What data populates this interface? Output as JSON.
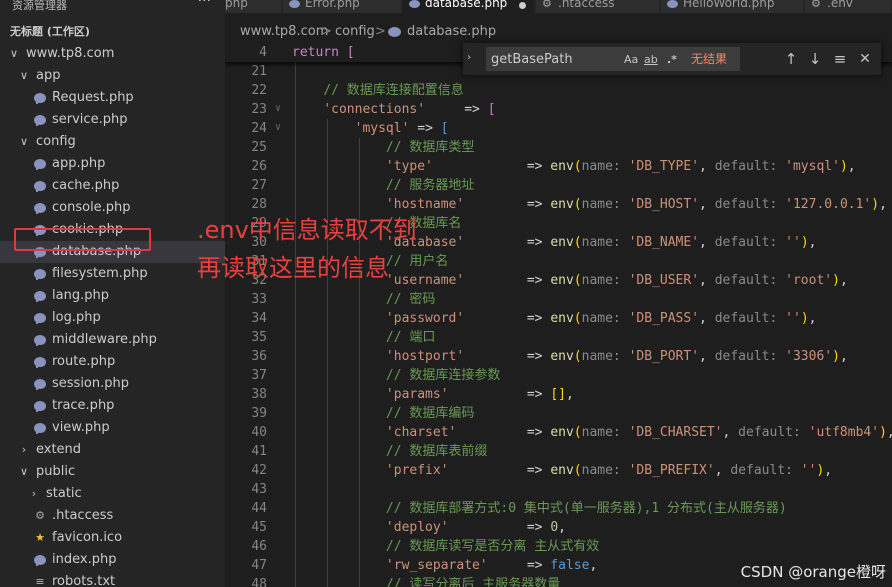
{
  "sidebar": {
    "title": "资源管理器",
    "more": "···",
    "workspace": "无标题 (工作区)",
    "rows": [
      {
        "label": "www.tp8.com",
        "kind": "folder-open",
        "indent": 0
      },
      {
        "label": "app",
        "kind": "folder-open",
        "indent": 1
      },
      {
        "label": "Request.php",
        "kind": "php",
        "indent": 2
      },
      {
        "label": "service.php",
        "kind": "php",
        "indent": 2
      },
      {
        "label": "config",
        "kind": "folder-open",
        "indent": 1
      },
      {
        "label": "app.php",
        "kind": "php",
        "indent": 2
      },
      {
        "label": "cache.php",
        "kind": "php",
        "indent": 2
      },
      {
        "label": "console.php",
        "kind": "php",
        "indent": 2
      },
      {
        "label": "cookie.php",
        "kind": "php",
        "indent": 2
      },
      {
        "label": "database.php",
        "kind": "php",
        "indent": 2,
        "selected": true
      },
      {
        "label": "filesystem.php",
        "kind": "php",
        "indent": 2
      },
      {
        "label": "lang.php",
        "kind": "php",
        "indent": 2
      },
      {
        "label": "log.php",
        "kind": "php",
        "indent": 2
      },
      {
        "label": "middleware.php",
        "kind": "php",
        "indent": 2
      },
      {
        "label": "route.php",
        "kind": "php",
        "indent": 2
      },
      {
        "label": "session.php",
        "kind": "php",
        "indent": 2
      },
      {
        "label": "trace.php",
        "kind": "php",
        "indent": 2
      },
      {
        "label": "view.php",
        "kind": "php",
        "indent": 2
      },
      {
        "label": "extend",
        "kind": "folder-closed",
        "indent": 1
      },
      {
        "label": "public",
        "kind": "folder-open",
        "indent": 1
      },
      {
        "label": "static",
        "kind": "folder-closed",
        "indent": 2
      },
      {
        "label": ".htaccess",
        "kind": "gear",
        "indent": 2
      },
      {
        "label": "favicon.ico",
        "kind": "star",
        "indent": 2
      },
      {
        "label": "index.php",
        "kind": "php",
        "indent": 2
      },
      {
        "label": "robots.txt",
        "kind": "txt",
        "indent": 2
      }
    ]
  },
  "tabs": [
    {
      "label": "php",
      "icon": "none",
      "active": false
    },
    {
      "label": "Error.php",
      "icon": "php-icon",
      "active": false
    },
    {
      "label": "database.php",
      "icon": "php-icon",
      "active": true,
      "dirty": true
    },
    {
      "label": ".htaccess",
      "icon": "gear-icon",
      "active": false
    },
    {
      "label": "HelloWorld.php",
      "icon": "php-icon",
      "active": false
    },
    {
      "label": ".env",
      "icon": "gear-icon",
      "active": false
    }
  ],
  "breadcrumb": [
    "www.tp8.com",
    "config",
    "database.php"
  ],
  "breadcrumb_sep": ">",
  "find": {
    "value": "getBasePath",
    "match_case": "Aa",
    "whole_word": "ab",
    "regex": ".*",
    "result": "无结果",
    "up": "↑",
    "down": "↓",
    "selection": "≡",
    "close": "✕"
  },
  "sticky": {
    "num": "4",
    "text": "return ["
  },
  "lines": [
    {
      "num": "21",
      "html": ""
    },
    {
      "num": "22",
      "html": "    <span class='c'>// 数据库连接配置信息</span>"
    },
    {
      "num": "23",
      "html": "    <span class='s'>'connections'</span>     <span class='o'>=&gt;</span> <span class='p'>[</span>"
    },
    {
      "num": "24",
      "html": "        <span class='s'>'mysql'</span> <span class='o'>=&gt;</span> <span class='bl'>[</span>"
    },
    {
      "num": "25",
      "html": "            <span class='c'>// 数据库类型</span>"
    },
    {
      "num": "26",
      "html": "            <span class='s'>'type'</span>            <span class='o'>=&gt;</span> <span class='f'>env</span><span class='b'>(</span><span class='h'>name:</span> <span class='s'>'DB_TYPE'</span>, <span class='h'>default:</span> <span class='s'>'mysql'</span><span class='b'>)</span>,"
    },
    {
      "num": "27",
      "html": "            <span class='c'>// 服务器地址</span>"
    },
    {
      "num": "28",
      "html": "            <span class='s'>'hostname'</span>        <span class='o'>=&gt;</span> <span class='f'>env</span><span class='b'>(</span><span class='h'>name:</span> <span class='s'>'DB_HOST'</span>, <span class='h'>default:</span> <span class='s'>'127.0.0.1'</span><span class='b'>)</span>,"
    },
    {
      "num": "29",
      "html": "            <span class='c'>// 数据库名</span>"
    },
    {
      "num": "30",
      "html": "            <span class='s'>'database'</span>        <span class='o'>=&gt;</span> <span class='f'>env</span><span class='b'>(</span><span class='h'>name:</span> <span class='s'>'DB_NAME'</span>, <span class='h'>default:</span> <span class='s'>''</span><span class='b'>)</span>,"
    },
    {
      "num": "31",
      "html": "            <span class='c'>// 用户名</span>"
    },
    {
      "num": "32",
      "html": "            <span class='s'>'username'</span>        <span class='o'>=&gt;</span> <span class='f'>env</span><span class='b'>(</span><span class='h'>name:</span> <span class='s'>'DB_USER'</span>, <span class='h'>default:</span> <span class='s'>'root'</span><span class='b'>)</span>,"
    },
    {
      "num": "33",
      "html": "            <span class='c'>// 密码</span>"
    },
    {
      "num": "34",
      "html": "            <span class='s'>'password'</span>        <span class='o'>=&gt;</span> <span class='f'>env</span><span class='b'>(</span><span class='h'>name:</span> <span class='s'>'DB_PASS'</span>, <span class='h'>default:</span> <span class='s'>''</span><span class='b'>)</span>,"
    },
    {
      "num": "35",
      "html": "            <span class='c'>// 端口</span>"
    },
    {
      "num": "36",
      "html": "            <span class='s'>'hostport'</span>        <span class='o'>=&gt;</span> <span class='f'>env</span><span class='b'>(</span><span class='h'>name:</span> <span class='s'>'DB_PORT'</span>, <span class='h'>default:</span> <span class='s'>'3306'</span><span class='b'>)</span>,"
    },
    {
      "num": "37",
      "html": "            <span class='c'>// 数据库连接参数</span>"
    },
    {
      "num": "38",
      "html": "            <span class='s'>'params'</span>          <span class='o'>=&gt;</span> <span class='b'>[]</span>,"
    },
    {
      "num": "39",
      "html": "            <span class='c'>// 数据库编码</span>"
    },
    {
      "num": "40",
      "html": "            <span class='s'>'charset'</span>         <span class='o'>=&gt;</span> <span class='f'>env</span><span class='b'>(</span><span class='h'>name:</span> <span class='s'>'DB_CHARSET'</span>, <span class='h'>default:</span> <span class='s'>'utf8mb4'</span><span class='b'>)</span>,"
    },
    {
      "num": "41",
      "html": "            <span class='c'>// 数据库表前缀</span>"
    },
    {
      "num": "42",
      "html": "            <span class='s'>'prefix'</span>          <span class='o'>=&gt;</span> <span class='f'>env</span><span class='b'>(</span><span class='h'>name:</span> <span class='s'>'DB_PREFIX'</span>, <span class='h'>default:</span> <span class='s'>''</span><span class='b'>)</span>,"
    },
    {
      "num": "43",
      "html": ""
    },
    {
      "num": "44",
      "html": "            <span class='c'>// 数据库部署方式:0 集中式(单一服务器),1 分布式(主从服务器)</span>"
    },
    {
      "num": "45",
      "html": "            <span class='s'>'deploy'</span>          <span class='o'>=&gt;</span> <span class='n'>0</span>,"
    },
    {
      "num": "46",
      "html": "            <span class='c'>// 数据库读写是否分离 主从式有效</span>"
    },
    {
      "num": "47",
      "html": "            <span class='s'>'rw_separate'</span>     <span class='o'>=&gt;</span> <span class='bl'>false</span>,"
    },
    {
      "num": "48",
      "html": "            <span class='c'>// 读写分离后 主服务器数量</span>"
    }
  ],
  "annotation": {
    "line1": ".env中信息读取不到",
    "line2": "再读取这里的信息",
    "color": "#e8403f"
  },
  "watermark": "CSDN @orange橙呀"
}
